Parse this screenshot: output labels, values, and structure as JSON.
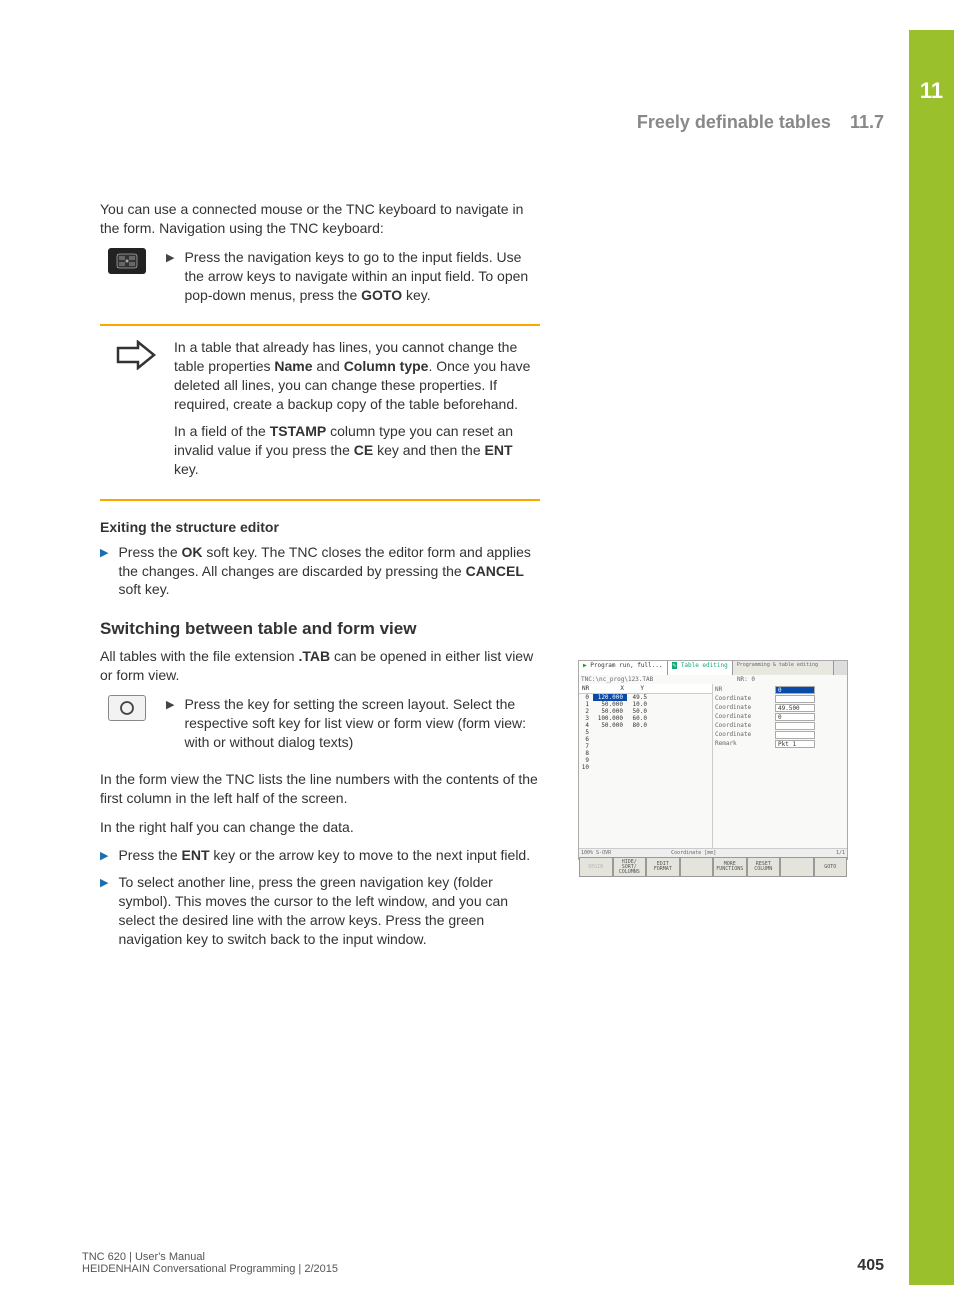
{
  "chapter_number": "11",
  "header": {
    "title": "Freely definable tables",
    "section": "11.7"
  },
  "intro_para": "You can use a connected mouse or the TNC keyboard to navigate in the form. Navigation using the TNC keyboard:",
  "nav_bullet": {
    "pre": "Press the navigation keys to go to the input fields. Use the arrow keys to navigate within an input field. To open pop-down menus, press the ",
    "key": "GOTO",
    "post": " key."
  },
  "note": {
    "p1_a": "In a table that already has lines, you cannot change the table properties ",
    "p1_name": "Name",
    "p1_and": " and ",
    "p1_col": "Column type",
    "p1_b": ". Once you have deleted all lines, you can change these properties. If required, create a backup copy of the table beforehand.",
    "p2_a": "In a field of the ",
    "p2_ts": "TSTAMP",
    "p2_b": " column type you can reset an invalid value if you press the ",
    "p2_ce": "CE",
    "p2_c": " key and then the ",
    "p2_ent": "ENT",
    "p2_d": " key."
  },
  "exit_heading": "Exiting the structure editor",
  "exit_bullet": {
    "a": "Press the ",
    "ok": "OK",
    "b": " soft key. The TNC closes the editor form and applies the changes. All changes are discarded by pressing the ",
    "cancel": "CANCEL",
    "c": " soft key."
  },
  "switch_heading": "Switching between table and form view",
  "switch_intro": {
    "a": "All tables with the file extension ",
    "ext": ".TAB",
    "b": " can be opened in either list view or form view."
  },
  "layout_bullet": "Press the key for setting the screen layout. Select the respective soft key for list view or form view (form view: with or without dialog texts)",
  "form_para": "In the form view the TNC lists the line numbers with the contents of the first column in the left half of the screen.",
  "right_para": "In the right half you can change the data.",
  "ent_bullet": {
    "a": "Press the ",
    "ent": "ENT",
    "b": " key or the arrow key to move to the next input field."
  },
  "nav2_bullet": "To select another line, press the green navigation key (folder symbol). This moves the cursor to the left window, and you can select the desired line with the arrow keys. Press the green navigation key to switch back to the input window.",
  "screenshot": {
    "mode_left": "Program run, full...",
    "mode_right": "Table editing",
    "subtitle": "Programming & table editing",
    "path": "TNC:\\nc_prog\\123.TAB",
    "nr_label": "NR: 0",
    "cols": [
      "NR",
      "X",
      "Y"
    ],
    "rows": [
      [
        "0",
        "120.000",
        "49.5"
      ],
      [
        "1",
        "50.000",
        "10.0"
      ],
      [
        "2",
        "50.000",
        "50.0"
      ],
      [
        "3",
        "100.000",
        "60.0"
      ],
      [
        "4",
        "50.000",
        "80.0"
      ],
      [
        "5",
        "",
        ""
      ],
      [
        "6",
        "",
        ""
      ],
      [
        "7",
        "",
        ""
      ],
      [
        "8",
        "",
        ""
      ],
      [
        "9",
        "",
        ""
      ],
      [
        "10",
        "",
        ""
      ]
    ],
    "form_fields": [
      {
        "lbl": "NR",
        "val": "0",
        "hl": true
      },
      {
        "lbl": "Coordinate",
        "val": ""
      },
      {
        "lbl": "Coordinate",
        "val": "49.500"
      },
      {
        "lbl": "Coordinate",
        "val": "0"
      },
      {
        "lbl": "Coordinate",
        "val": ""
      },
      {
        "lbl": "Coordinate",
        "val": ""
      },
      {
        "lbl": "Remark",
        "val": "Pkt 1"
      }
    ],
    "status_left": "100% S-OVR",
    "status_mid": "Coordinate [mm]",
    "status_right": "1/1",
    "softkeys": [
      "BEGIN",
      "HIDE/\nSORT/\nCOLUMNS",
      "EDIT\nFORMAT",
      "",
      "MORE\nFUNCTIONS",
      "RESET\nCOLUMN",
      "",
      "GOTO"
    ]
  },
  "footer": {
    "line1": "TNC 620 | User's Manual",
    "line2": "HEIDENHAIN Conversational Programming | 2/2015",
    "page": "405"
  }
}
